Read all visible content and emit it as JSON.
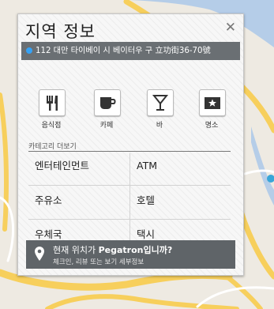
{
  "map": {
    "road_color": "#f7cf5c",
    "water_color": "#b5cde8",
    "land_color": "#eeeae2"
  },
  "panel": {
    "title": "지역 정보",
    "close_icon": "close-icon",
    "address": "112 대만 타이베이 시 베이터우 구 立功街36-70號",
    "categories": [
      {
        "label": "음식점",
        "icon": "fork-knife-icon"
      },
      {
        "label": "카페",
        "icon": "coffee-cup-icon"
      },
      {
        "label": "바",
        "icon": "cocktail-glass-icon"
      },
      {
        "label": "명소",
        "icon": "star-ticket-icon"
      }
    ],
    "more_categories_label": "카테고리 더보기",
    "category_grid": [
      [
        "엔터테인먼트",
        "ATM"
      ],
      [
        "주유소",
        "호텔"
      ],
      [
        "우체국",
        "택시"
      ]
    ],
    "checkin": {
      "prefix": "현재 위치가 ",
      "place": "Pegatron",
      "suffix": "입니까?",
      "subtitle": "체크인, 리뷰 또는 보기 세부정보",
      "icon": "location-pin-icon"
    }
  }
}
